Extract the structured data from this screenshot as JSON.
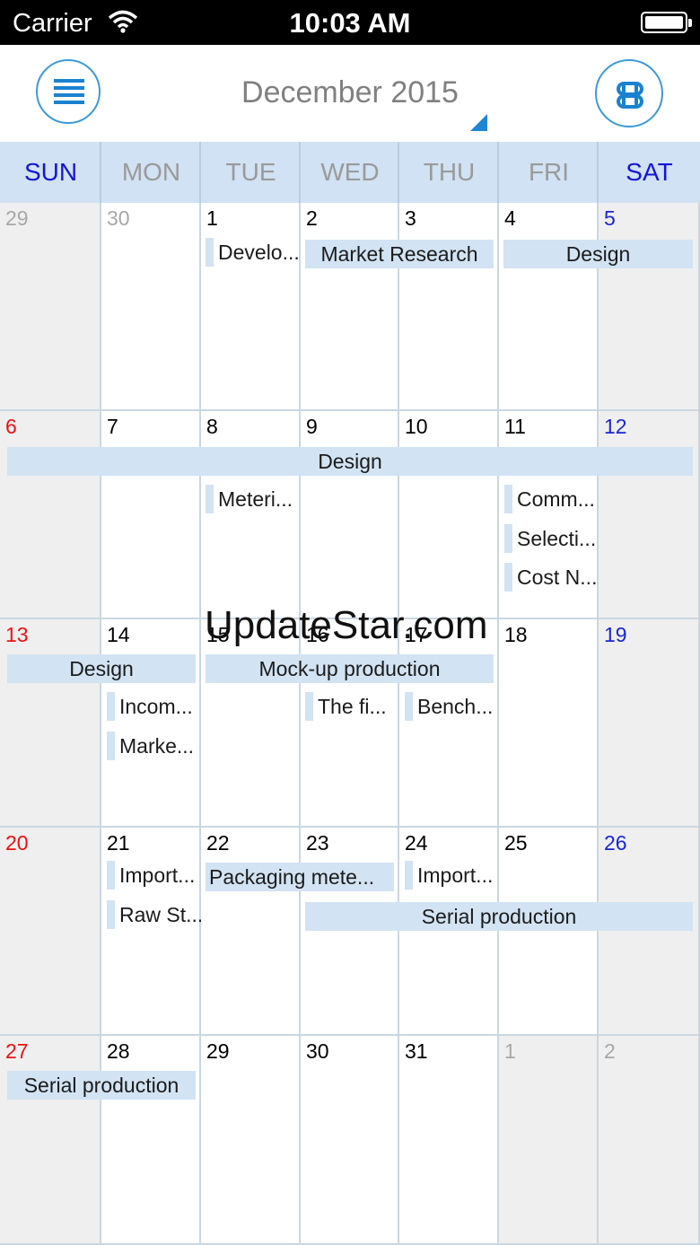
{
  "status_bar": {
    "carrier": "Carrier",
    "time": "10:03 AM"
  },
  "header": {
    "title": "December 2015"
  },
  "weekdays": [
    "SUN",
    "MON",
    "TUE",
    "WED",
    "THU",
    "FRI",
    "SAT"
  ],
  "weeks": [
    [
      "29",
      "30",
      "1",
      "2",
      "3",
      "4",
      "5"
    ],
    [
      "6",
      "7",
      "8",
      "9",
      "10",
      "11",
      "12"
    ],
    [
      "13",
      "14",
      "15",
      "16",
      "17",
      "18",
      "19"
    ],
    [
      "20",
      "21",
      "22",
      "23",
      "24",
      "25",
      "26"
    ],
    [
      "27",
      "28",
      "29",
      "30",
      "31",
      "1",
      "2"
    ]
  ],
  "events": {
    "w1_develo": "Develo...",
    "w1_market_research": "Market Research",
    "w1_design": "Design",
    "w2_design": "Design",
    "w2_meteri": "Meteri...",
    "w2_comm": "Comm...",
    "w2_selecti": "Selecti...",
    "w2_cost": "Cost N...",
    "w3_design": "Design",
    "w3_mockup": "Mock-up production",
    "w3_incom": "Incom...",
    "w3_marke": "Marke...",
    "w3_the_fi": "The fi...",
    "w3_bench": "Bench...",
    "w4_import1": "Import...",
    "w4_raw": "Raw St...",
    "w4_packaging": "Packaging mete...",
    "w4_import2": "Import...",
    "w4_serial": "Serial production",
    "w5_serial": "Serial production"
  },
  "watermark": "UpdateStar.com",
  "colors": {
    "accent": "#1e86d4",
    "event_bg": "#d2e3f3",
    "header_bg": "#d0e2f3",
    "sunday": "#ee1111",
    "saturday": "#1a25d6"
  }
}
